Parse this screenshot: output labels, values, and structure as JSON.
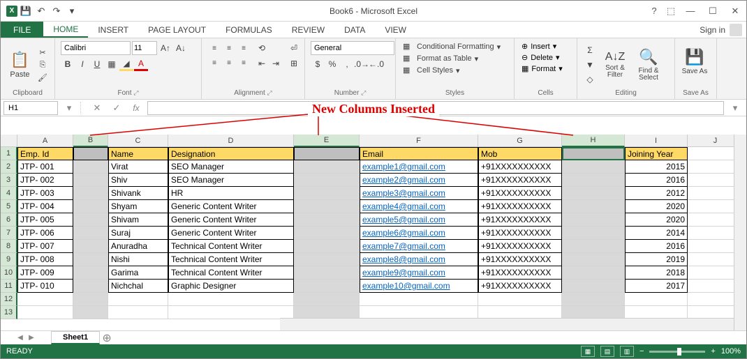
{
  "app": {
    "title": "Book6 - Microsoft Excel"
  },
  "tabs": {
    "file": "FILE",
    "home": "HOME",
    "insert": "INSERT",
    "pagelayout": "PAGE LAYOUT",
    "formulas": "FORMULAS",
    "review": "REVIEW",
    "data": "DATA",
    "view": "VIEW",
    "signin": "Sign in"
  },
  "ribbon": {
    "clipboard": {
      "label": "Clipboard",
      "paste": "Paste"
    },
    "font": {
      "label": "Font",
      "family": "Calibri",
      "size": "11"
    },
    "alignment": {
      "label": "Alignment"
    },
    "number": {
      "label": "Number",
      "format": "General"
    },
    "styles": {
      "label": "Styles",
      "cond": "Conditional Formatting",
      "table": "Format as Table",
      "cell": "Cell Styles"
    },
    "cells": {
      "label": "Cells",
      "insert": "Insert",
      "delete": "Delete",
      "format": "Format"
    },
    "editing": {
      "label": "Editing",
      "sort": "Sort & Filter",
      "find": "Find & Select"
    },
    "saveas": {
      "label": "Save As",
      "btn": "Save As"
    }
  },
  "annotation": "New Columns Inserted",
  "namebox": "H1",
  "columns": [
    "A",
    "B",
    "C",
    "D",
    "E",
    "F",
    "G",
    "H",
    "I",
    "J"
  ],
  "headers": {
    "A": "Emp. Id",
    "B": "",
    "C": "Name",
    "D": "Designation",
    "E": "",
    "F": "Email",
    "G": "Mob",
    "H": "",
    "I": "Joining Year",
    "J": ""
  },
  "rows": [
    {
      "n": 2,
      "A": "JTP- 001",
      "C": "Virat",
      "D": "SEO Manager",
      "F": "example1@gmail.com",
      "G": "+91XXXXXXXXXX",
      "I": "2015"
    },
    {
      "n": 3,
      "A": "JTP- 002",
      "C": "Shiv",
      "D": "SEO Manager",
      "F": "example2@gmail.com",
      "G": "+91XXXXXXXXXX",
      "I": "2016"
    },
    {
      "n": 4,
      "A": "JTP- 003",
      "C": "Shivank",
      "D": "HR",
      "F": "example3@gmail.com",
      "G": "+91XXXXXXXXXX",
      "I": "2012"
    },
    {
      "n": 5,
      "A": "JTP- 004",
      "C": "Shyam",
      "D": "Generic Content Writer",
      "F": "example4@gmail.com",
      "G": "+91XXXXXXXXXX",
      "I": "2020"
    },
    {
      "n": 6,
      "A": "JTP- 005",
      "C": "Shivam",
      "D": "Generic Content Writer",
      "F": "example5@gmail.com",
      "G": "+91XXXXXXXXXX",
      "I": "2020"
    },
    {
      "n": 7,
      "A": "JTP- 006",
      "C": "Suraj",
      "D": "Generic Content Writer",
      "F": "example6@gmail.com",
      "G": "+91XXXXXXXXXX",
      "I": "2014"
    },
    {
      "n": 8,
      "A": "JTP- 007",
      "C": "Anuradha",
      "D": "Technical Content Writer",
      "F": "example7@gmail.com",
      "G": "+91XXXXXXXXXX",
      "I": "2016"
    },
    {
      "n": 9,
      "A": "JTP- 008",
      "C": "Nishi",
      "D": "Technical Content Writer",
      "F": "example8@gmail.com",
      "G": "+91XXXXXXXXXX",
      "I": "2019"
    },
    {
      "n": 10,
      "A": "JTP- 009",
      "C": "Garima",
      "D": "Technical Content Writer",
      "F": "example9@gmail.com",
      "G": "+91XXXXXXXXXX",
      "I": "2018"
    },
    {
      "n": 11,
      "A": "JTP- 010",
      "C": "Nichchal",
      "D": "Graphic Designer",
      "F": "example10@gmail.com",
      "G": "+91XXXXXXXXXX",
      "I": "2017"
    }
  ],
  "sheet": {
    "name": "Sheet1"
  },
  "status": {
    "ready": "READY",
    "zoom": "100%"
  }
}
